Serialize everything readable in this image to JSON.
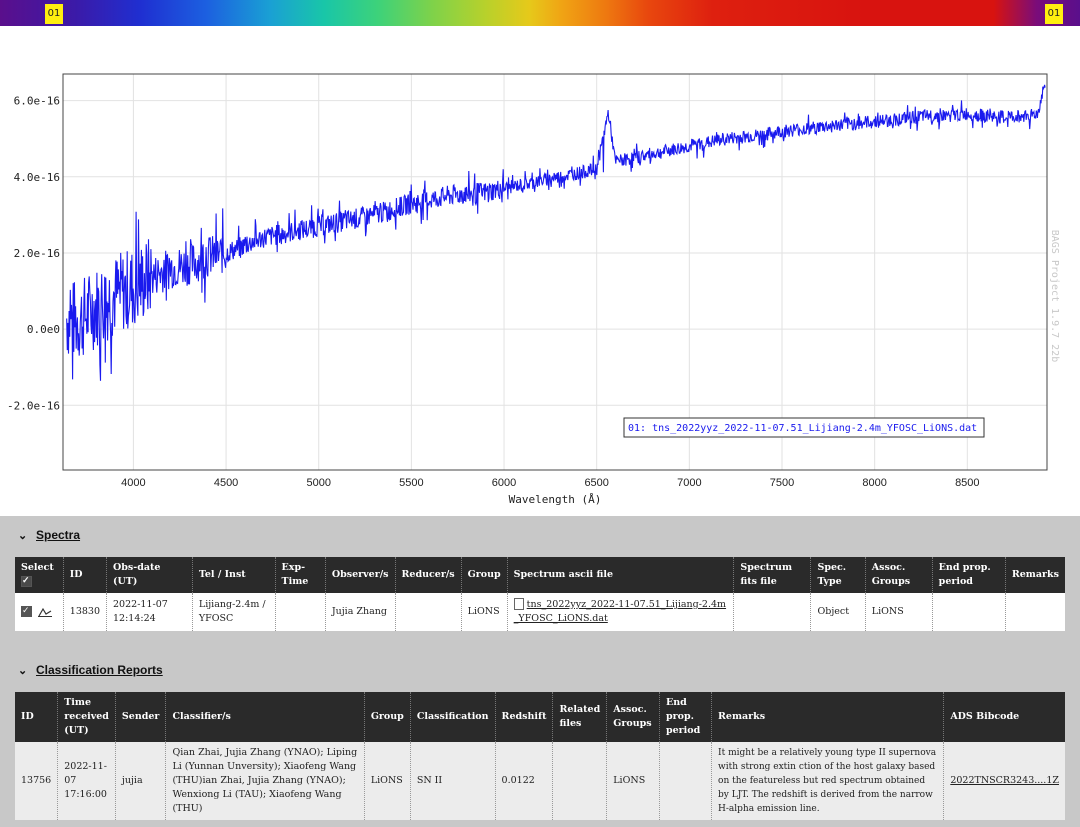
{
  "top_bar": {
    "left_tag": "01",
    "right_tag": "01"
  },
  "chart_data": {
    "type": "line",
    "xlabel": "Wavelength (Å)",
    "ylabel": "",
    "xlim": [
      3620,
      8930
    ],
    "ylim": [
      -3.7e-16,
      6.7e-16
    ],
    "x_ticks": [
      "4000",
      "4500",
      "5000",
      "5500",
      "6000",
      "6500",
      "7000",
      "7500",
      "8000",
      "8500"
    ],
    "y_ticks": [
      "6.0e-16",
      "4.0e-16",
      "2.0e-16",
      "0.0e0",
      "-2.0e-16"
    ],
    "watermark": "BAGS Project 1.9.7 22b",
    "series": [
      {
        "name": "01: tns_2022yyz_2022-11-07.51_Lijiang-2.4m_YFOSC_LiONS.dat",
        "color": "#1a1aee",
        "x": [
          3640,
          3700,
          3800,
          3900,
          4000,
          4100,
          4200,
          4300,
          4400,
          4500,
          4600,
          4700,
          4800,
          4900,
          5000,
          5100,
          5200,
          5300,
          5400,
          5500,
          5600,
          5700,
          5800,
          5900,
          6000,
          6100,
          6200,
          6300,
          6400,
          6500,
          6563,
          6600,
          6700,
          6800,
          6900,
          7000,
          7100,
          7200,
          7300,
          7400,
          7500,
          7600,
          7700,
          7800,
          7900,
          8000,
          8100,
          8200,
          8300,
          8400,
          8500,
          8600,
          8700,
          8800,
          8880,
          8920
        ],
        "y": [
          3e-17,
          2e-17,
          6e-17,
          9e-17,
          1.1e-16,
          1.4e-16,
          1.6e-16,
          1.7e-16,
          1.9e-16,
          2e-16,
          2.2e-16,
          2.4e-16,
          2.5e-16,
          2.6e-16,
          2.7e-16,
          2.8e-16,
          2.9e-16,
          3e-16,
          3.15e-16,
          3.3e-16,
          3.4e-16,
          3.5e-16,
          3.55e-16,
          3.6e-16,
          3.7e-16,
          3.8e-16,
          3.9e-16,
          4e-16,
          4.1e-16,
          4.2e-16,
          5.7e-16,
          4.4e-16,
          4.5e-16,
          4.6e-16,
          4.7e-16,
          4.8e-16,
          4.9e-16,
          5e-16,
          5.05e-16,
          5.1e-16,
          5.2e-16,
          5.25e-16,
          5.3e-16,
          5.35e-16,
          5.4e-16,
          5.45e-16,
          5.5e-16,
          5.55e-16,
          5.6e-16,
          5.6e-16,
          5.65e-16,
          5.6e-16,
          5.55e-16,
          5.6e-16,
          5.65e-16,
          6.5e-16
        ]
      }
    ]
  },
  "spectra": {
    "title": "Spectra",
    "headers": [
      "Select",
      "ID",
      "Obs-date (UT)",
      "Tel / Inst",
      "Exp-Time",
      "Observer/s",
      "Reducer/s",
      "Group",
      "Spectrum ascii file",
      "Spectrum fits file",
      "Spec. Type",
      "Assoc. Groups",
      "End prop. period",
      "Remarks"
    ],
    "row": {
      "id": "13830",
      "obs_date": "2022-11-07 12:14:24",
      "tel_inst": "Lijiang-2.4m / YFOSC",
      "exp_time": "",
      "observers": "Jujia Zhang",
      "reducers": "",
      "group": "LiONS",
      "ascii_file": "tns_2022yyz_2022-11-07.51_Lijiang-2.4m_YFOSC_LiONS.dat",
      "fits_file": "",
      "spec_type": "Object",
      "assoc_groups": "LiONS",
      "end_prop": "",
      "remarks": ""
    }
  },
  "classification": {
    "title": "Classification Reports",
    "headers": [
      "ID",
      "Time received (UT)",
      "Sender",
      "Classifier/s",
      "Group",
      "Classification",
      "Redshift",
      "Related files",
      "Assoc. Groups",
      "End prop. period",
      "Remarks",
      "ADS Bibcode"
    ],
    "row": {
      "id": "13756",
      "time": "2022-11-07 17:16:00",
      "sender": "jujia",
      "classifiers": "Qian Zhai, Jujia Zhang (YNAO); Liping Li (Yunnan Unversity); Xiaofeng Wang (THU)ian Zhai, Jujia Zhang (YNAO); Wenxiong Li (TAU); Xiaofeng Wang (THU)",
      "group": "LiONS",
      "classification": "SN II",
      "redshift": "0.0122",
      "related_files": "",
      "assoc_groups": "LiONS",
      "end_prop": "",
      "remarks": "It might be a relatively young type II supernova with strong extin ction of the host galaxy based on the featureless but red spectrum obtained by LJT. The redshift is derived from the narrow H-alpha emission line.",
      "bibcode": "2022TNSCR3243....1Z"
    }
  }
}
